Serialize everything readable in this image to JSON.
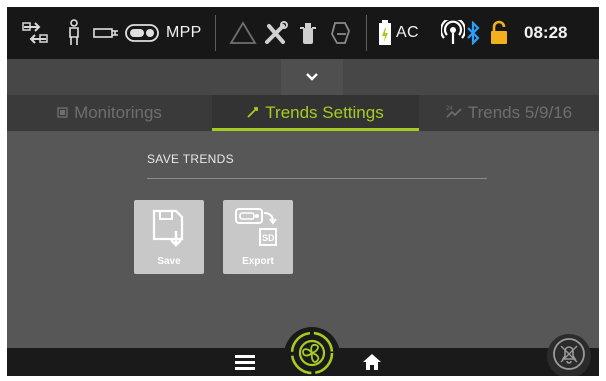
{
  "status_bar": {
    "mode_label": "MPP",
    "power_label": "AC",
    "time": "08:28",
    "icons": [
      "patient-connections-icon",
      "patient-icon",
      "circuit-icon",
      "toggle-icon",
      "alarm-triangle-icon",
      "tools-icon",
      "fire-extinguisher-icon",
      "mask-icon",
      "battery-icon",
      "wifi-icon",
      "bluetooth-icon",
      "lock-icon"
    ],
    "colors": {
      "accent": "#a6cc23",
      "bluetooth": "#2aa0ff",
      "lock": "#f2b01e"
    }
  },
  "tabs": [
    {
      "label": "Monitorings",
      "icon": "monitor-icon",
      "active": false
    },
    {
      "label": "Trends Settings",
      "icon": "trend-settings-icon",
      "active": true
    },
    {
      "label": "Trends 5/9/16",
      "icon": "trends-24h-icon",
      "active": false
    }
  ],
  "content": {
    "section_title": "SAVE TRENDS",
    "buttons": [
      {
        "label": "Save",
        "icon": "floppy-save-icon"
      },
      {
        "label": "Export",
        "icon": "sd-export-icon"
      }
    ],
    "sd_label": "SD"
  },
  "bottom_bar": {
    "icons": [
      "menu-icon",
      "ventilation-fan-icon",
      "home-icon",
      "alarm-silence-icon"
    ]
  }
}
